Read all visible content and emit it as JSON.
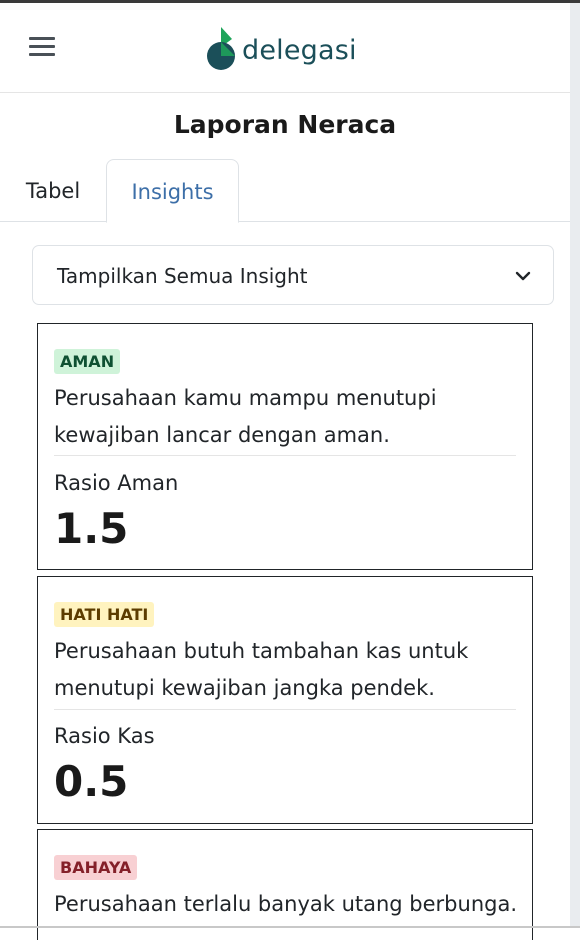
{
  "header": {
    "logo_text": "delegasi",
    "brand_colors": {
      "dark": "#1b4f59",
      "green": "#1fa45a"
    }
  },
  "page": {
    "title": "Laporan Neraca"
  },
  "tabs": [
    {
      "label": "Tabel",
      "active": false
    },
    {
      "label": "Insights",
      "active": true
    }
  ],
  "filter": {
    "selected": "Tampilkan Semua Insight",
    "icon": "chevron-down-icon"
  },
  "insights": [
    {
      "badge": "AMAN",
      "status_color": "#cff3d9",
      "description": "Perusahaan kamu mampu menutupi kewajiban lancar dengan aman.",
      "metric_label": "Rasio Aman",
      "metric_value": "1.5"
    },
    {
      "badge": "HATI HATI",
      "status_color": "#fff3bf",
      "description": "Perusahaan butuh tambahan kas untuk menutupi kewajiban jangka pendek.",
      "metric_label": "Rasio Kas",
      "metric_value": "0.5"
    },
    {
      "badge": "BAHAYA",
      "status_color": "#f8d0d3",
      "description": "Perusahaan terlalu banyak utang berbunga."
    }
  ]
}
